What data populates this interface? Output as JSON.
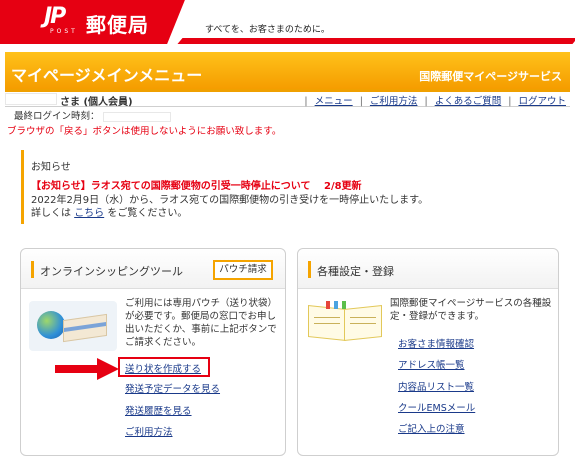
{
  "header": {
    "logo_mark": "JP",
    "logo_post": "POST",
    "brand": "郵便局",
    "slogan": "すべてを、お客さまのために。"
  },
  "banner": {
    "title": "マイページメインメニュー",
    "service": "国際郵便マイページサービス"
  },
  "user": {
    "name_suffix": "さま (個人会員)",
    "last_login_label": "最終ログイン時刻："
  },
  "top_links": [
    "メニュー",
    "ご利用方法",
    "よくあるご質問",
    "ログアウト"
  ],
  "warning": "ブラウザの「戻る」ボタンは使用しないようにお願い致します。",
  "notice": {
    "title": "お知らせ",
    "headline": "【お知らせ】ラオス宛ての国際郵便物の引受一時停止について",
    "updated": "2/8更新",
    "line1": "2022年2月9日（水）から、ラオス宛ての国際郵便物の引き受けを一時停止いたします。",
    "line2_prefix": "詳しくは",
    "line2_link": "こちら",
    "line2_suffix": "をご覧ください。"
  },
  "shipping_panel": {
    "title": "オンラインシッピングツール",
    "pouch_button": "パウチ請求",
    "description": "ご利用には専用パウチ（送り状袋）が必要です。郵便局の窓口でお申し出いただくか、事前に上記ボタンでご請求ください。",
    "links": [
      "送り状を作成する",
      "発送予定データを見る",
      "発送履歴を見る",
      "ご利用方法"
    ]
  },
  "settings_panel": {
    "title": "各種設定・登録",
    "description": "国際郵便マイページサービスの各種設定・登録ができます。",
    "links": [
      "お客さま情報確認",
      "アドレス帳一覧",
      "内容品リスト一覧",
      "クールEMSメール",
      "ご記入上の注意"
    ]
  },
  "colors": {
    "brand_red": "#e60012",
    "banner_orange": "#f59d00",
    "accent_orange": "#f5a400",
    "link_blue": "#1a3a8a"
  }
}
